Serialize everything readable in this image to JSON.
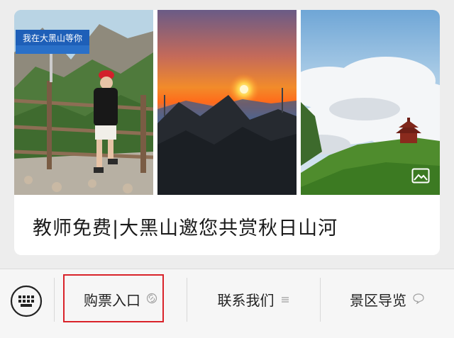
{
  "article": {
    "title": "教师免费|大黑山邀您共赏秋日山河",
    "photos": [
      {
        "sign_text": "我在大黑山等你"
      },
      {},
      {
        "overlay_icon": "image-gallery-icon"
      }
    ]
  },
  "menu": {
    "keyboard_icon": "keyboard-icon",
    "items": [
      {
        "label": "购票入口",
        "icon": "link-icon"
      },
      {
        "label": "联系我们",
        "icon": "menu-lines-icon"
      },
      {
        "label": "景区导览",
        "icon": "chat-bubble-icon"
      }
    ]
  },
  "colors": {
    "highlight_border": "#d9232a",
    "background": "#ededed",
    "menu_background": "#f6f6f6"
  }
}
